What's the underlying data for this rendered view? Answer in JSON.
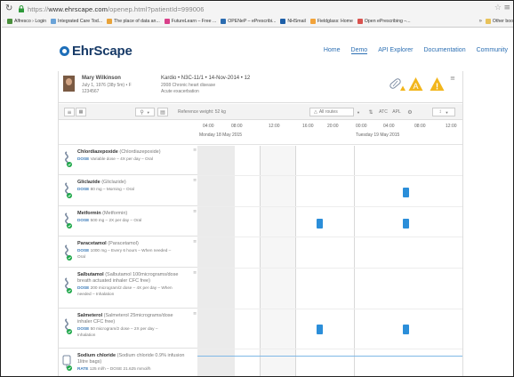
{
  "browser": {
    "url_scheme": "https://",
    "url_host": "www.ehrscape.com",
    "url_path": "/openep.html?patientId=999006",
    "bookmarks": [
      {
        "label": "Alfresco › Login",
        "color": "#4a8f3c"
      },
      {
        "label": "Integrated Care Tod...",
        "color": "#6aa3d8"
      },
      {
        "label": "The place of data an...",
        "color": "#e8a33a"
      },
      {
        "label": "FutureLearn – Free ...",
        "color": "#d9408a"
      },
      {
        "label": "OPENeP – ePrescribi...",
        "color": "#2b6cb0"
      },
      {
        "label": "NHSmail",
        "color": "#1d5fa8"
      },
      {
        "label": "Fieldglass: Home",
        "color": "#f2a33a"
      },
      {
        "label": "Open ePrescribing –...",
        "color": "#d9534f"
      }
    ],
    "bookmarks_more": "»",
    "other_bookmarks": "Other boo"
  },
  "app": {
    "logo_text": "EhrScape",
    "nav": [
      {
        "label": "Home",
        "active": false
      },
      {
        "label": "Demo",
        "active": true
      },
      {
        "label": "API Explorer",
        "active": false
      },
      {
        "label": "Documentation",
        "active": false
      },
      {
        "label": "Community",
        "active": false
      }
    ]
  },
  "patient": {
    "name": "Mary Wilkinson",
    "dob": "July 1, 1976 (38y 5m) • F",
    "nhs": "1234567",
    "encounter": "Kardio • N3C-11/1 • 14-Nov-2014 • 12",
    "diagnosis_1": "2008 Chronic heart disease",
    "diagnosis_2": "Acute exacerbation",
    "alert_a": "A",
    "alert_excl": "!"
  },
  "toolbar": {
    "reference_weight": "Reference weight: 52 kg",
    "routes": "All routes",
    "atc": "ATC",
    "apl": "APL"
  },
  "timeline": {
    "times": [
      "04:00",
      "08:00",
      "12:00",
      "16:00",
      "20:00",
      "00:00",
      "04:00",
      "08:00",
      "12:00"
    ],
    "day1": "Monday 18 May 2015",
    "day2": "Tuesday 19 May 2015"
  },
  "medications": [
    {
      "name": "Chlordiazepoxide",
      "generic": "(Chlordiazepoxide)",
      "dose_lines": [
        "DOSE Variable dose – 4X per day – Oral"
      ],
      "given": []
    },
    {
      "name": "Gliclazide",
      "generic": "(Gliclazide)",
      "dose_lines": [
        "DOSE 80 mg – Morning – Oral"
      ],
      "given": [
        "08:00 Tue"
      ]
    },
    {
      "name": "Metformin",
      "generic": "(Metformin)",
      "dose_lines": [
        "DOSE 500 mg – 2X per day – Oral"
      ],
      "given": [
        "18:00 Mon",
        "08:00 Tue"
      ]
    },
    {
      "name": "Paracetamol",
      "generic": "(Paracetamol)",
      "dose_lines": [
        "DOSE 1000 mg – Every 6 hours – When needed –",
        "Oral"
      ],
      "given": []
    },
    {
      "name": "Salbutamol",
      "generic": "(Salbutamol 100micrograms/dose",
      "name_lines": [
        "breath actuated inhaler CFC free)"
      ],
      "dose_lines": [
        "DOSE 200 microgram/2 dose – 4X per day – When",
        "needed – Inhalation"
      ],
      "given": []
    },
    {
      "name": "Salmeterol",
      "generic": "(Salmeterol 25micrograms/dose",
      "name_lines": [
        "inhaler CFC free)"
      ],
      "dose_lines": [
        "DOSE 50 microgram/2 dose – 2X per day –",
        "Inhalation"
      ],
      "given": [
        "18:00 Mon",
        "08:00 Tue"
      ]
    },
    {
      "name": "Sodium chloride",
      "generic": "(Sodium chloride 0.9% infusion",
      "name_lines": [
        "1litre bags)"
      ],
      "dose_lines": [
        "RATE 125 ml/h – DOSE 21.625 mmol/h"
      ],
      "given": []
    }
  ],
  "colors": {
    "brand": "#173a67",
    "link": "#2c6fb3",
    "dose_given": "#2b8ed9",
    "warning": "#f2b61c",
    "med_icon_check": "#1fa84a"
  }
}
